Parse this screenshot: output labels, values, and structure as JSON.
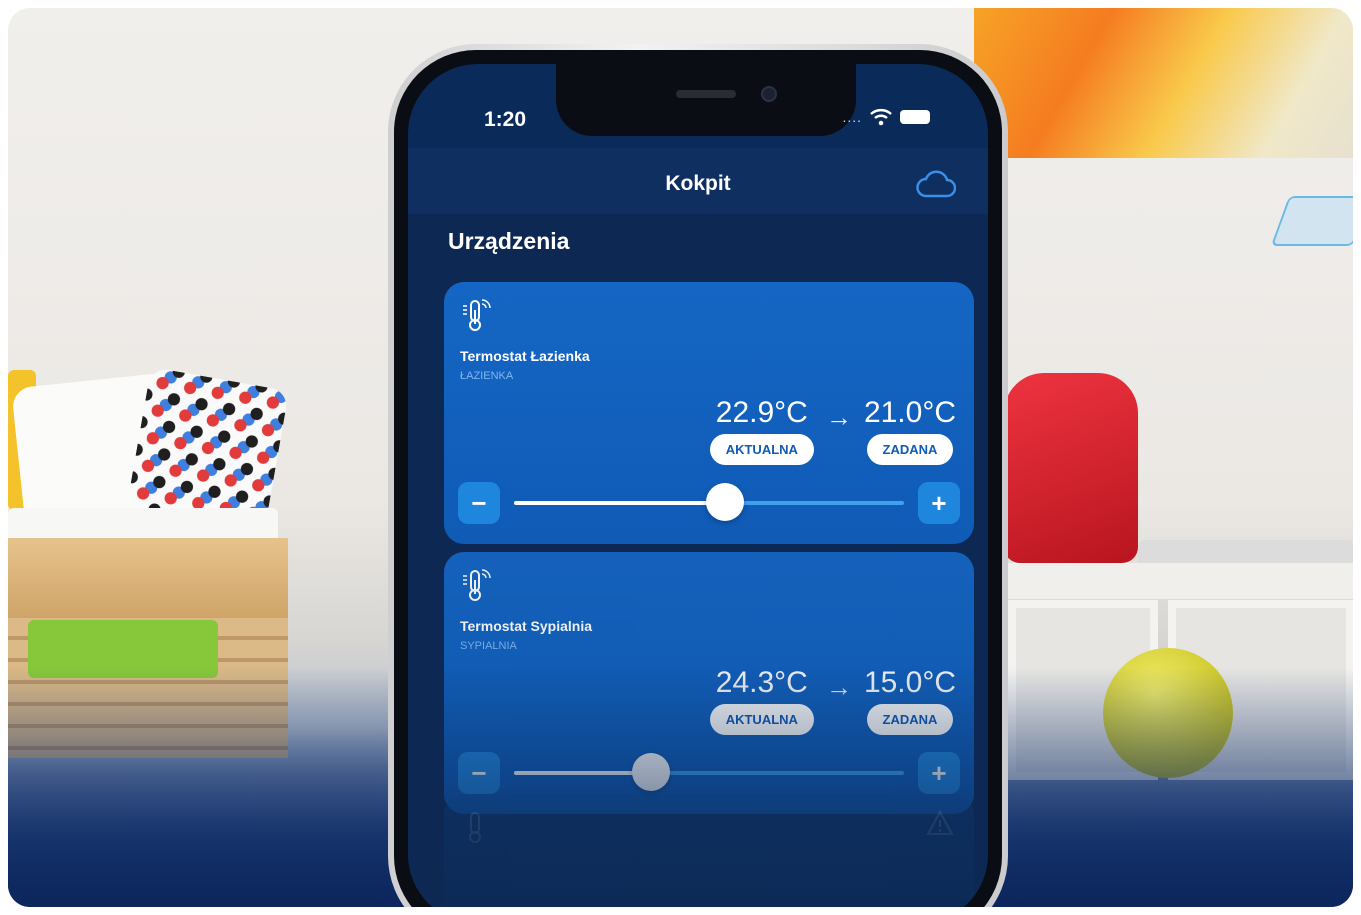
{
  "status_bar": {
    "time": "1:20",
    "signal": "...."
  },
  "header": {
    "title": "Kokpit",
    "cloud_icon": "cloud-icon"
  },
  "section": {
    "title": "Urządzenia"
  },
  "devices": [
    {
      "name": "Termostat Łazienka",
      "room": "ŁAZIENKA",
      "current_temp": "22.9°C",
      "current_label": "AKTUALNA",
      "arrow": "→",
      "target_temp": "21.0°C",
      "target_label": "ZADANA",
      "minus": "−",
      "plus": "+",
      "slider_level": 0.54
    },
    {
      "name": "Termostat Sypialnia",
      "room": "SYPIALNIA",
      "current_temp": "24.3°C",
      "current_label": "AKTUALNA",
      "arrow": "→",
      "target_temp": "15.0°C",
      "target_label": "ZADANA",
      "minus": "−",
      "plus": "+",
      "slider_level": 0.35
    }
  ],
  "colors": {
    "card": "#1566c4",
    "header": "#0f2f61",
    "accent": "#3ea1f0"
  }
}
